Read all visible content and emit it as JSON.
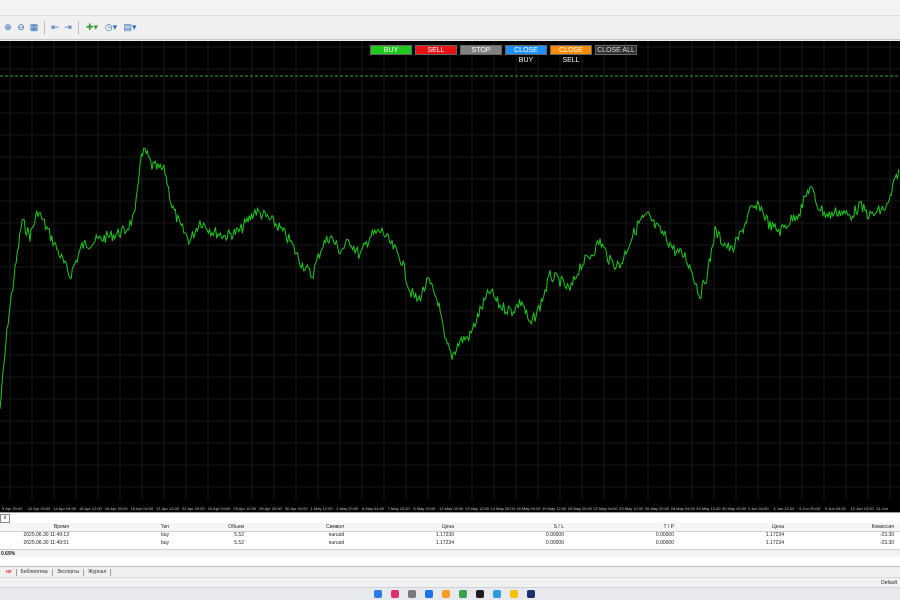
{
  "toolbar": {
    "icons": [
      "zoom-in-icon",
      "zoom-out-icon",
      "grid-icon",
      "chart-shift-icon",
      "autoscroll-icon",
      "indicators-icon",
      "periods-icon",
      "templates-icon"
    ]
  },
  "trade_panel": {
    "buy": "BUY",
    "sell": "SELL",
    "stop": "STOP",
    "close_buy": "CLOSE BUY",
    "close_sell": "CLOSE SELL",
    "close_all": "CLOSE ALL"
  },
  "colors": {
    "chart_bg": "#000000",
    "price_line": "#1fc81f",
    "grid": "#2e2e2e",
    "dashed_level": "#2aa82a"
  },
  "x_axis_labels": [
    "9 Apr 20:00",
    "10 Apr 20:00",
    "14 Apr 04:00",
    "15 Apr 12:00",
    "16 Apr 20:00",
    "18 Apr 04:00",
    "21 Apr 12:00",
    "22 Apr 20:00",
    "24 Apr 04:00",
    "25 Apr 12:00",
    "28 Apr 20:00",
    "30 Apr 04:00",
    "1 May 12:00",
    "2 May 20:00",
    "6 May 04:00",
    "7 May 12:00",
    "8 May 20:00",
    "12 May 04:00",
    "13 May 12:00",
    "14 May 20:00",
    "16 May 04:00",
    "19 May 12:00",
    "20 May 20:00",
    "22 May 04:00",
    "23 May 12:00",
    "26 May 20:00",
    "28 May 04:00",
    "29 May 12:00",
    "30 May 20:00",
    "3 Jun 04:00",
    "4 Jun 12:00",
    "5 Jun 20:00",
    "9 Jun 04:00",
    "10 Jun 12:00",
    "11 Jun"
  ],
  "terminal": {
    "corner": "x",
    "columns": [
      "Время",
      "Тип",
      "Объем",
      "Символ",
      "Цена",
      "S / L",
      "T / P",
      "Цена",
      "Комиссия"
    ],
    "rows": [
      [
        "2025.06.30 11:49:13",
        "buy",
        "5.52",
        "eurusd",
        "1.17230",
        "0.00000",
        "0.00000",
        "1.17234",
        "-23.30"
      ],
      [
        "2025.06.30 11:49:51",
        "buy",
        "5.52",
        "eurusd",
        "1.17234",
        "0.00000",
        "0.00000",
        "1.17234",
        "-23.30"
      ]
    ],
    "summary": "0.69%"
  },
  "tabs": [
    {
      "label": "ия",
      "active": true
    },
    {
      "label": "Библиотека",
      "active": false
    },
    {
      "label": "Эксперты",
      "active": false
    },
    {
      "label": "Журнал",
      "active": false
    }
  ],
  "status": {
    "profile": "Default"
  }
}
